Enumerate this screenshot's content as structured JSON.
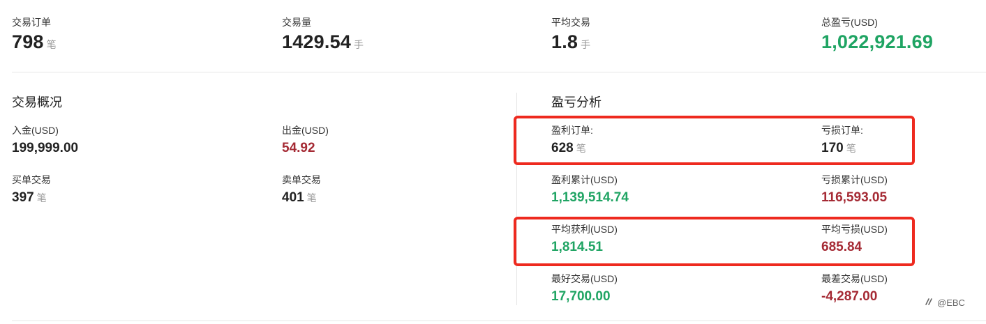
{
  "summary": {
    "orders": {
      "label": "交易订单",
      "value": "798",
      "unit": "笔"
    },
    "volume": {
      "label": "交易量",
      "value": "1429.54",
      "unit": "手"
    },
    "avg_trade": {
      "label": "平均交易",
      "value": "1.8",
      "unit": "手"
    },
    "total_pnl": {
      "label": "总盈亏(USD)",
      "value": "1,022,921.69"
    }
  },
  "overview": {
    "title": "交易概况",
    "deposit": {
      "label": "入金(USD)",
      "value": "199,999.00"
    },
    "withdraw": {
      "label": "出金(USD)",
      "value": "54.92"
    },
    "buy_trades": {
      "label": "买单交易",
      "value": "397",
      "unit": "笔"
    },
    "sell_trades": {
      "label": "卖单交易",
      "value": "401",
      "unit": "笔"
    }
  },
  "pnl_analysis": {
    "title": "盈亏分析",
    "profit_orders": {
      "label": "盈利订单:",
      "value": "628",
      "unit": "笔"
    },
    "loss_orders": {
      "label": "亏损订单:",
      "value": "170",
      "unit": "笔"
    },
    "cum_profit": {
      "label": "盈利累计(USD)",
      "value": "1,139,514.74"
    },
    "cum_loss": {
      "label": "亏损累计(USD)",
      "value": "116,593.05"
    },
    "avg_profit": {
      "label": "平均获利(USD)",
      "value": "1,814.51"
    },
    "avg_loss": {
      "label": "平均亏损(USD)",
      "value": "685.84"
    },
    "best_trade": {
      "label": "最好交易(USD)",
      "value": "17,700.00"
    },
    "worst_trade": {
      "label": "最差交易(USD)",
      "value": "-4,287.00"
    }
  },
  "watermark": {
    "text": "@EBC"
  },
  "colors": {
    "green": "#1fa463",
    "red": "#a52a34",
    "highlight": "#ee2a1f"
  }
}
